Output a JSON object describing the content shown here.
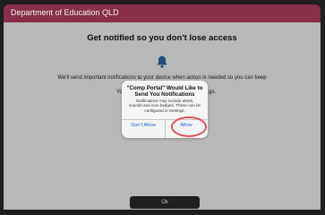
{
  "header": {
    "title": "Department of Education QLD"
  },
  "page": {
    "title": "Get notified so you don't lose access",
    "body_line1": "We'll send important notifications to your device when action is needed so you can keep",
    "body_line2_left": "Yo",
    "body_line2_right": "gs.",
    "ok_label": "Ok"
  },
  "alert": {
    "title_line1": "\"Comp Portal\" Would Like to",
    "title_line2": "Send You Notifications",
    "message_line1": "Notifications may include alerts,",
    "message_line2": "sounds and icon badges. These can be",
    "message_line3": "configured in Settings.",
    "dont_allow": "Don't Allow",
    "allow": "Allow"
  },
  "colors": {
    "header": "#8a2f4a",
    "alert_button": "#1f66d1",
    "highlight": "#e05059"
  }
}
